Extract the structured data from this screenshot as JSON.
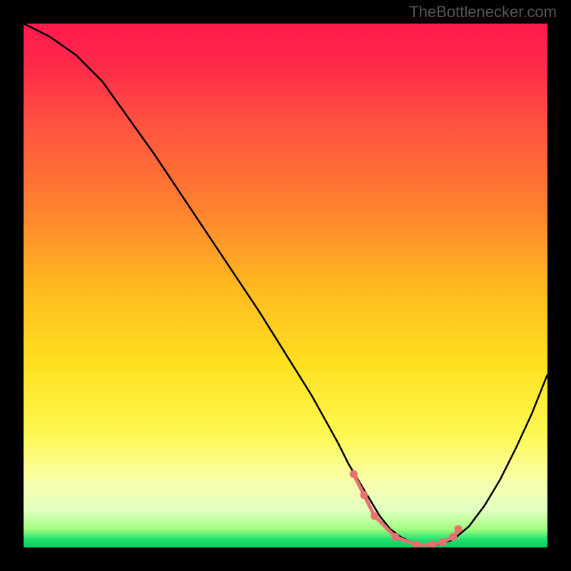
{
  "watermark": "TheBottlenecker.com",
  "chart_data": {
    "type": "line",
    "title": "",
    "xlabel": "",
    "ylabel": "",
    "xlim": [
      0,
      100
    ],
    "ylim": [
      0,
      100
    ],
    "x": [
      0,
      2,
      5,
      10,
      15,
      20,
      25,
      30,
      35,
      40,
      45,
      50,
      55,
      60,
      62,
      65,
      68,
      70,
      72,
      74,
      76,
      79,
      82,
      85,
      88,
      91,
      94,
      97,
      100
    ],
    "values": [
      100,
      99,
      97.5,
      94,
      89,
      82,
      75,
      67.5,
      60,
      52.5,
      45,
      37,
      29,
      20,
      16,
      11,
      6,
      3.5,
      2,
      1,
      0.5,
      0.5,
      1.5,
      4,
      8,
      13,
      19,
      25.5,
      33
    ],
    "optimal_zone": {
      "x_start": 63,
      "x_end": 83
    },
    "markers": {
      "x": [
        63,
        65,
        67,
        71,
        75,
        78,
        80,
        82,
        83
      ],
      "y": [
        14,
        10,
        6,
        2,
        0.5,
        0.5,
        1,
        2,
        3.5
      ]
    },
    "gradient_stops": [
      {
        "offset": 0.0,
        "color": "#ff1a4d"
      },
      {
        "offset": 0.08,
        "color": "#ff2a4a"
      },
      {
        "offset": 0.2,
        "color": "#ff5540"
      },
      {
        "offset": 0.35,
        "color": "#ff8030"
      },
      {
        "offset": 0.5,
        "color": "#ffb820"
      },
      {
        "offset": 0.65,
        "color": "#ffe020"
      },
      {
        "offset": 0.78,
        "color": "#fff850"
      },
      {
        "offset": 0.88,
        "color": "#f8ffb0"
      },
      {
        "offset": 0.93,
        "color": "#e0ffc0"
      },
      {
        "offset": 0.965,
        "color": "#a0ff80"
      },
      {
        "offset": 0.985,
        "color": "#20e070"
      },
      {
        "offset": 1.0,
        "color": "#00d060"
      }
    ]
  }
}
